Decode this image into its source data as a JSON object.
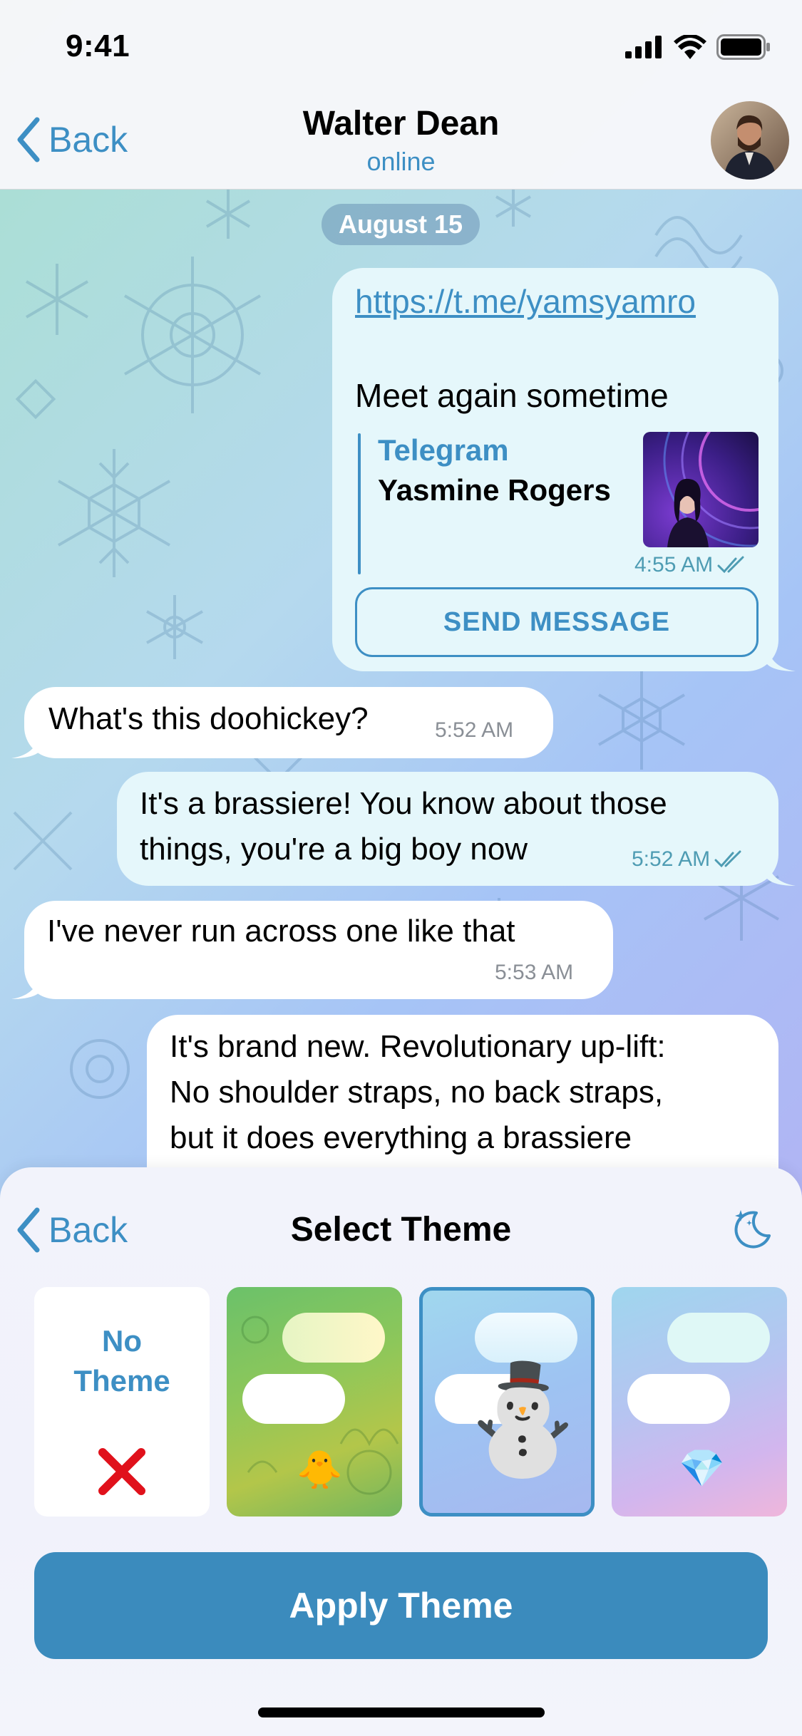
{
  "status_bar": {
    "time": "9:41"
  },
  "nav": {
    "back_label": "Back",
    "title": "Walter Dean",
    "subtitle": "online"
  },
  "chat": {
    "date_label": "August 15",
    "messages": [
      {
        "direction": "out",
        "link": "https://t.me/yamsyamro",
        "text": "Meet again sometime",
        "preview_site": "Telegram",
        "preview_title": "Yasmine Rogers",
        "time": "4:55 AM",
        "button_label": "SEND MESSAGE"
      },
      {
        "direction": "in",
        "text": "What's this doohickey?",
        "time": "5:52 AM"
      },
      {
        "direction": "out",
        "line1": "It's a brassiere! You know about those",
        "line2": "things, you're a big boy now",
        "time": "5:52 AM"
      },
      {
        "direction": "in",
        "text": "I've never run across one like that",
        "time": "5:53 AM"
      },
      {
        "direction": "out",
        "line1": "It's brand new. Revolutionary up-lift:",
        "line2": "No shoulder straps, no back straps,",
        "line3": "but it does everything a brassiere"
      }
    ]
  },
  "theme_sheet": {
    "back_label": "Back",
    "title": "Select Theme",
    "night_mode_icon": "moon-stars-icon",
    "themes": [
      {
        "label": "No Theme",
        "label_line1": "No",
        "label_line2": "Theme",
        "icon": "red-x-icon"
      },
      {
        "emoji": "🐥",
        "bg": "#8cc56b"
      },
      {
        "emoji": "⛄",
        "bg": "#9ac8ef",
        "selected": true
      },
      {
        "emoji": "💎",
        "bg": "#c9b7ee"
      }
    ],
    "apply_label": "Apply Theme"
  },
  "colors": {
    "accent": "#3d8fc4",
    "apply_button": "#3b8bbd",
    "outgoing_bubble": "#e5f7fb",
    "incoming_bubble": "#ffffff"
  }
}
